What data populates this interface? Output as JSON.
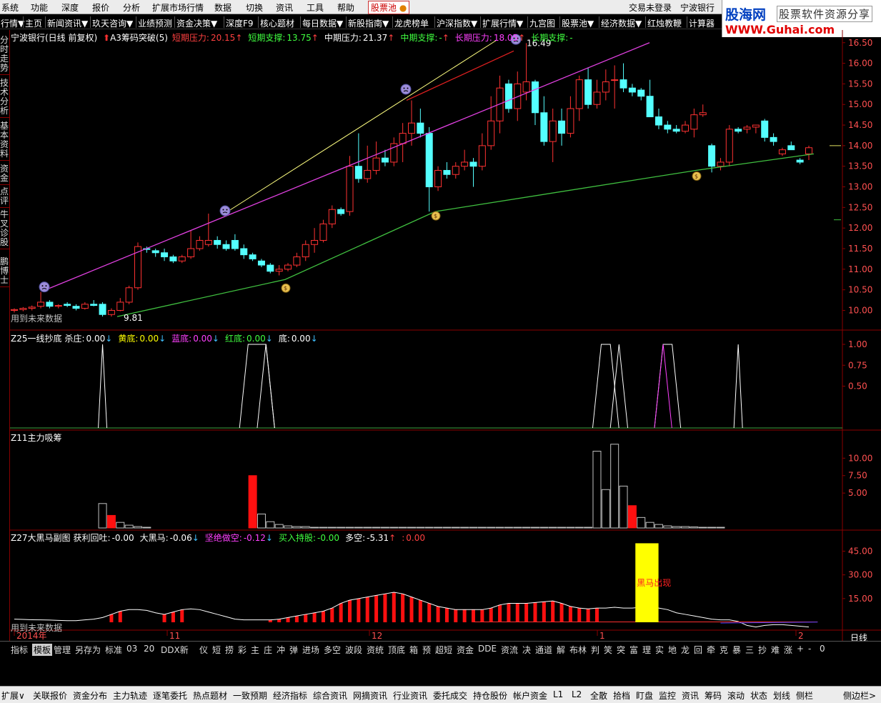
{
  "menu": {
    "items": [
      "系统",
      "功能",
      "深度",
      "报价",
      "分析",
      "扩展市场行情",
      "数据",
      "切换",
      "资讯",
      "工具",
      "帮助"
    ],
    "stock_pool": "股票池",
    "login": "交易未登录",
    "stock_name": "宁波银行"
  },
  "logo": {
    "title": "股海网",
    "slogan": "股票软件资源分享",
    "url": "WWW.Guhai.com"
  },
  "toolbar": {
    "items": [
      "行情▼",
      "主页",
      "新闻资讯▼",
      "玖天咨询▼",
      "业绩预测",
      "资金决策▼",
      "深度F9",
      "核心题材",
      "每日数据▼",
      "新股指南▼",
      "龙虎榜单",
      "沪深指数▼",
      "扩展行情▼",
      "九宫图",
      "股票池▼",
      "经济数据▼",
      "红烛教鞭",
      "计算器"
    ]
  },
  "left_tabs": [
    "分时走势",
    "技术分析",
    "基本资料",
    "资金",
    "点评",
    "牛叉诊股",
    "鹏博士"
  ],
  "main_chart": {
    "header": {
      "name": "宁波银行(日线 前复权)",
      "indicator": "A3筹码突破(5)",
      "items": [
        {
          "label": "短期压力:",
          "value": "20.15",
          "arrow": "↑",
          "color": "#ff4040"
        },
        {
          "label": "短期支撑:",
          "value": "13.75",
          "arrow": "↑",
          "color": "#40ff40"
        },
        {
          "label": "中期压力:",
          "value": "21.37",
          "arrow": "↑",
          "color": "#ffffff"
        },
        {
          "label": "中期支撑:",
          "value": "-",
          "arrow": "↑",
          "color": "#40ff40"
        },
        {
          "label": "长期压力:",
          "value": "18.05",
          "arrow": "↑",
          "color": "#ff40ff"
        },
        {
          "label": "长期支撑:",
          "value": "-",
          "arrow": "",
          "color": "#40ff40"
        }
      ]
    },
    "future_note": "用到未来数据",
    "high_label": "16.49",
    "low_label": "9.81",
    "y_ticks": [
      "16.50",
      "16.00",
      "15.50",
      "15.00",
      "14.50",
      "14.00",
      "13.50",
      "13.00",
      "12.50",
      "12.00",
      "11.50",
      "11.00",
      "10.50",
      "10.00"
    ]
  },
  "chart_data": {
    "type": "candlestick",
    "ylim": [
      9.8,
      16.6
    ],
    "candles": [
      {
        "o": 10.0,
        "h": 10.05,
        "l": 9.95,
        "c": 10.02
      },
      {
        "o": 10.02,
        "h": 10.08,
        "l": 9.98,
        "c": 10.05
      },
      {
        "o": 10.05,
        "h": 10.12,
        "l": 10.0,
        "c": 10.08
      },
      {
        "o": 10.1,
        "h": 10.45,
        "l": 10.05,
        "c": 10.2
      },
      {
        "o": 10.2,
        "h": 10.25,
        "l": 10.05,
        "c": 10.1
      },
      {
        "o": 10.1,
        "h": 10.15,
        "l": 10.05,
        "c": 10.12
      },
      {
        "o": 10.15,
        "h": 10.2,
        "l": 10.08,
        "c": 10.12
      },
      {
        "o": 10.1,
        "h": 10.15,
        "l": 10.0,
        "c": 10.05
      },
      {
        "o": 10.05,
        "h": 10.2,
        "l": 10.02,
        "c": 10.15
      },
      {
        "o": 10.15,
        "h": 10.25,
        "l": 10.1,
        "c": 10.12
      },
      {
        "o": 10.15,
        "h": 10.2,
        "l": 9.85,
        "c": 9.9
      },
      {
        "o": 9.9,
        "h": 10.05,
        "l": 9.85,
        "c": 10.0
      },
      {
        "o": 10.0,
        "h": 10.3,
        "l": 9.98,
        "c": 10.2
      },
      {
        "o": 10.2,
        "h": 10.6,
        "l": 10.15,
        "c": 10.55
      },
      {
        "o": 10.55,
        "h": 11.65,
        "l": 10.5,
        "c": 11.55
      },
      {
        "o": 11.5,
        "h": 11.55,
        "l": 11.4,
        "c": 11.48
      },
      {
        "o": 11.45,
        "h": 11.5,
        "l": 11.3,
        "c": 11.4
      },
      {
        "o": 11.4,
        "h": 11.5,
        "l": 11.2,
        "c": 11.3
      },
      {
        "o": 11.3,
        "h": 11.35,
        "l": 11.15,
        "c": 11.2
      },
      {
        "o": 11.2,
        "h": 11.35,
        "l": 11.15,
        "c": 11.3
      },
      {
        "o": 11.3,
        "h": 11.95,
        "l": 11.25,
        "c": 11.5
      },
      {
        "o": 11.5,
        "h": 11.8,
        "l": 11.45,
        "c": 11.7
      },
      {
        "o": 11.6,
        "h": 12.35,
        "l": 11.55,
        "c": 11.7
      },
      {
        "o": 11.7,
        "h": 11.8,
        "l": 11.5,
        "c": 11.6
      },
      {
        "o": 11.6,
        "h": 11.7,
        "l": 11.45,
        "c": 11.5
      },
      {
        "o": 11.7,
        "h": 11.85,
        "l": 11.45,
        "c": 11.5
      },
      {
        "o": 11.5,
        "h": 11.6,
        "l": 11.25,
        "c": 11.35
      },
      {
        "o": 11.35,
        "h": 11.4,
        "l": 11.2,
        "c": 11.25
      },
      {
        "o": 11.2,
        "h": 11.25,
        "l": 11.05,
        "c": 11.1
      },
      {
        "o": 11.1,
        "h": 11.15,
        "l": 10.9,
        "c": 10.95
      },
      {
        "o": 10.95,
        "h": 11.1,
        "l": 10.85,
        "c": 11.0
      },
      {
        "o": 11.0,
        "h": 11.15,
        "l": 10.95,
        "c": 11.1
      },
      {
        "o": 11.1,
        "h": 11.4,
        "l": 11.05,
        "c": 11.3
      },
      {
        "o": 11.3,
        "h": 11.7,
        "l": 11.2,
        "c": 11.6
      },
      {
        "o": 11.6,
        "h": 12.0,
        "l": 11.4,
        "c": 11.7
      },
      {
        "o": 11.7,
        "h": 12.2,
        "l": 11.65,
        "c": 12.1
      },
      {
        "o": 12.1,
        "h": 12.55,
        "l": 12.0,
        "c": 12.45
      },
      {
        "o": 12.45,
        "h": 12.5,
        "l": 12.3,
        "c": 12.35
      },
      {
        "o": 12.4,
        "h": 13.75,
        "l": 12.3,
        "c": 13.5
      },
      {
        "o": 13.5,
        "h": 14.3,
        "l": 13.1,
        "c": 13.2
      },
      {
        "o": 13.2,
        "h": 14.0,
        "l": 13.1,
        "c": 13.4
      },
      {
        "o": 13.4,
        "h": 14.1,
        "l": 13.3,
        "c": 13.7
      },
      {
        "o": 13.7,
        "h": 13.9,
        "l": 13.5,
        "c": 13.6
      },
      {
        "o": 13.6,
        "h": 14.2,
        "l": 13.5,
        "c": 14.05
      },
      {
        "o": 14.05,
        "h": 14.55,
        "l": 13.6,
        "c": 14.3
      },
      {
        "o": 14.3,
        "h": 15.1,
        "l": 14.0,
        "c": 14.55
      },
      {
        "o": 14.55,
        "h": 14.9,
        "l": 14.2,
        "c": 14.3
      },
      {
        "o": 14.3,
        "h": 14.45,
        "l": 12.4,
        "c": 13.0
      },
      {
        "o": 13.0,
        "h": 13.5,
        "l": 12.9,
        "c": 13.4
      },
      {
        "o": 13.4,
        "h": 13.6,
        "l": 13.2,
        "c": 13.3
      },
      {
        "o": 13.3,
        "h": 13.6,
        "l": 13.2,
        "c": 13.5
      },
      {
        "o": 13.5,
        "h": 13.9,
        "l": 13.4,
        "c": 13.6
      },
      {
        "o": 13.6,
        "h": 13.7,
        "l": 13.0,
        "c": 13.5
      },
      {
        "o": 13.5,
        "h": 14.3,
        "l": 13.4,
        "c": 14.0
      },
      {
        "o": 14.0,
        "h": 15.2,
        "l": 13.9,
        "c": 14.6
      },
      {
        "o": 14.6,
        "h": 15.7,
        "l": 14.3,
        "c": 15.4
      },
      {
        "o": 15.5,
        "h": 15.6,
        "l": 14.8,
        "c": 14.9
      },
      {
        "o": 14.9,
        "h": 15.8,
        "l": 14.6,
        "c": 15.5
      },
      {
        "o": 15.3,
        "h": 16.49,
        "l": 15.1,
        "c": 15.55
      },
      {
        "o": 15.55,
        "h": 15.6,
        "l": 14.5,
        "c": 14.8
      },
      {
        "o": 14.8,
        "h": 15.2,
        "l": 14.0,
        "c": 14.1
      },
      {
        "o": 14.1,
        "h": 14.9,
        "l": 13.6,
        "c": 14.6
      },
      {
        "o": 14.6,
        "h": 14.9,
        "l": 14.0,
        "c": 14.3
      },
      {
        "o": 14.3,
        "h": 15.2,
        "l": 14.2,
        "c": 14.9
      },
      {
        "o": 14.9,
        "h": 15.7,
        "l": 14.6,
        "c": 15.6
      },
      {
        "o": 15.6,
        "h": 15.9,
        "l": 14.9,
        "c": 15.0
      },
      {
        "o": 15.0,
        "h": 15.6,
        "l": 14.9,
        "c": 15.3
      },
      {
        "o": 15.3,
        "h": 15.85,
        "l": 15.1,
        "c": 15.55
      },
      {
        "o": 15.6,
        "h": 15.95,
        "l": 14.9,
        "c": 15.6
      },
      {
        "o": 15.6,
        "h": 16.0,
        "l": 15.3,
        "c": 15.4
      },
      {
        "o": 15.4,
        "h": 15.5,
        "l": 15.2,
        "c": 15.3
      },
      {
        "o": 15.35,
        "h": 15.4,
        "l": 15.1,
        "c": 15.2
      },
      {
        "o": 15.2,
        "h": 15.6,
        "l": 14.9,
        "c": 14.7
      },
      {
        "o": 14.7,
        "h": 14.9,
        "l": 14.4,
        "c": 14.5
      },
      {
        "o": 14.5,
        "h": 14.6,
        "l": 14.3,
        "c": 14.4
      },
      {
        "o": 14.4,
        "h": 14.5,
        "l": 14.3,
        "c": 14.35
      },
      {
        "o": 14.35,
        "h": 14.6,
        "l": 14.3,
        "c": 14.5
      },
      {
        "o": 14.4,
        "h": 14.9,
        "l": 14.2,
        "c": 14.75
      },
      {
        "o": 14.75,
        "h": 15.0,
        "l": 14.7,
        "c": 14.8
      },
      {
        "o": 14.0,
        "h": 14.05,
        "l": 13.35,
        "c": 13.5
      },
      {
        "o": 13.5,
        "h": 13.7,
        "l": 13.4,
        "c": 13.6
      },
      {
        "o": 13.6,
        "h": 14.5,
        "l": 13.5,
        "c": 14.4
      },
      {
        "o": 14.4,
        "h": 14.45,
        "l": 14.3,
        "c": 14.35
      },
      {
        "o": 14.4,
        "h": 14.5,
        "l": 14.3,
        "c": 14.45
      },
      {
        "o": 14.45,
        "h": 14.5,
        "l": 14.3,
        "c": 14.5
      },
      {
        "o": 14.6,
        "h": 14.65,
        "l": 14.1,
        "c": 14.2
      },
      {
        "o": 14.2,
        "h": 14.3,
        "l": 14.0,
        "c": 14.1
      },
      {
        "o": 13.8,
        "h": 13.95,
        "l": 13.75,
        "c": 13.9
      },
      {
        "o": 14.0,
        "h": 14.1,
        "l": 13.9,
        "c": 13.9
      },
      {
        "o": 13.65,
        "h": 13.7,
        "l": 13.55,
        "c": 13.6
      },
      {
        "o": 13.8,
        "h": 14.0,
        "l": 13.65,
        "c": 13.95
      }
    ]
  },
  "panel2": {
    "header_name": "Z25一线抄底",
    "items": [
      {
        "label": "杀庄:",
        "value": "0.00",
        "arrow": "↓",
        "color": "#ffffff"
      },
      {
        "label": "黄底:",
        "value": "0.00",
        "arrow": "↓",
        "color": "#ffff00"
      },
      {
        "label": "蓝底:",
        "value": "0.00",
        "arrow": "↓",
        "color": "#ff40ff"
      },
      {
        "label": "红底:",
        "value": "0.00",
        "arrow": "↓",
        "color": "#40ff40"
      },
      {
        "label": "底:",
        "value": "0.00",
        "arrow": "↓",
        "color": "#ffffff"
      }
    ],
    "y_ticks": [
      "1.00",
      "0.75",
      "0.50"
    ]
  },
  "panel3": {
    "header_name": "Z11主力吸筹",
    "y_ticks": [
      "10.00",
      "7.50",
      "5.00"
    ]
  },
  "panel4": {
    "header_name": "Z27大黑马副图",
    "items": [
      {
        "label": "获利回吐:",
        "value": "-0.00",
        "arrow": "",
        "color": "#ffffff"
      },
      {
        "label": "大黑马:",
        "value": "-0.06",
        "arrow": "↓",
        "color": "#ffffff"
      },
      {
        "label": "坚绝做空:",
        "value": "-0.12",
        "arrow": "↓",
        "color": "#ff40ff"
      },
      {
        "label": "买入持股:",
        "value": "-0.00",
        "arrow": "",
        "color": "#40ff40"
      },
      {
        "label": "多空:",
        "value": "-5.31",
        "arrow": "↑",
        "color": "#ffffff"
      },
      {
        "label": ":",
        "value": "0.00",
        "arrow": "",
        "color": "#ff4040"
      }
    ],
    "dark_horse_label": "黑马出现",
    "future_note": "用到未来数据",
    "y_ticks": [
      "45.00",
      "30.00",
      "15.00"
    ]
  },
  "x_axis": {
    "labels": [
      "2014年",
      "11",
      "12",
      "1",
      "2"
    ],
    "period": "日线"
  },
  "index_tabs": [
    "指标",
    "模板",
    "管理",
    "另存为",
    "标准",
    "03",
    "20",
    "DDX新",
    "仪",
    "短",
    "捞",
    "彩",
    "主",
    "庄",
    "冲",
    "弹",
    "进场",
    "多空",
    "波段",
    "资统",
    "顶底",
    "箱",
    "预",
    "超短",
    "资金",
    "DDE",
    "资流",
    "决",
    "通道",
    "解",
    "布林",
    "判",
    "笑",
    "突",
    "富",
    "理",
    "实",
    "地",
    "龙",
    "回",
    "牵",
    "克",
    "暴",
    "三",
    "抄",
    "难",
    "涨",
    "+",
    "-",
    "0"
  ],
  "page_tabs": [
    "扩展∨",
    "关联报价",
    "资金分布",
    "主力轨迹",
    "逐笔委托",
    "热点题材",
    "一致预期",
    "经济指标",
    "综合资讯",
    "网摘资讯",
    "行业资讯",
    "委托成交",
    "持仓股份",
    "帐户资金",
    "L1",
    "L2",
    "全散",
    "拾档",
    "盯盘",
    "监控",
    "资讯",
    "筹码",
    "滚动",
    "状态",
    "划线",
    "侧栏",
    "侧边栏>"
  ],
  "colors": {
    "up": "#ff3232",
    "down": "#54ffff",
    "axis": "#8b0000",
    "magenta": "#e040e0",
    "yellow_line": "#ffff80",
    "green_line": "#40c040"
  }
}
